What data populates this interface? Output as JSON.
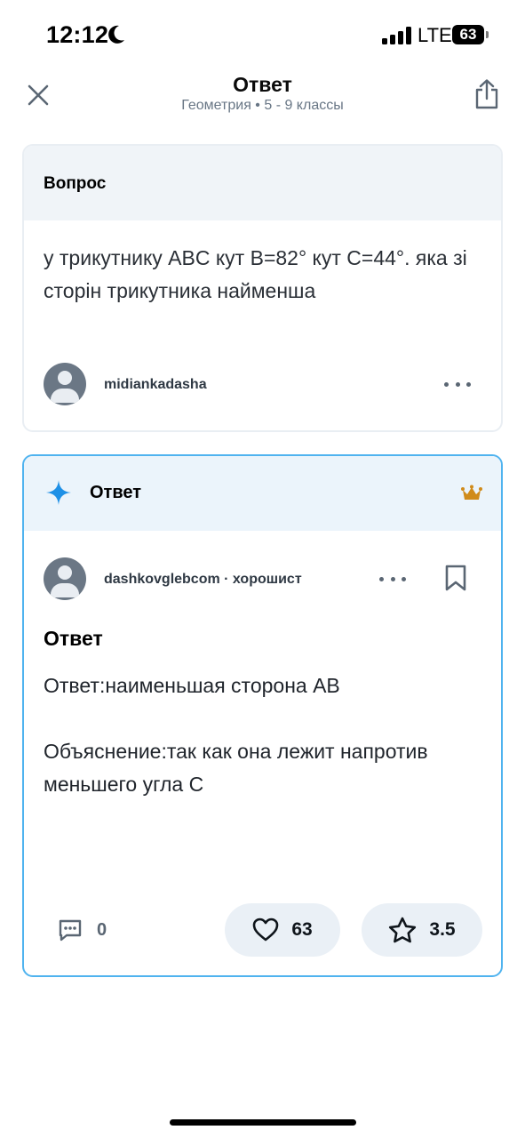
{
  "status_bar": {
    "time": "12:12",
    "network": "LTE",
    "battery": "63"
  },
  "header": {
    "title": "Ответ",
    "subtitle": "Геометрия • 5 - 9 классы"
  },
  "question_card": {
    "label": "Вопрос",
    "text": "у трикутнику ABC кут B=82° кут C=44°. яка зі сторін трикутника найменша",
    "author": "midiankadasha"
  },
  "answer_card": {
    "label": "Ответ",
    "author": "dashkovglebcom · хорошист",
    "heading": "Ответ",
    "paragraph1": "Ответ:наименьшая сторона АВ",
    "paragraph2": "Объяснение:так как она лежит напротив меньшего угла С",
    "comments": "0",
    "likes": "63",
    "rating": "3.5"
  },
  "colors": {
    "accent": "#4fb3ef",
    "sparkle": "#1e90e6",
    "crown": "#d08b1a"
  },
  "icons": [
    "moon-icon",
    "signal-icon",
    "close-icon",
    "share-icon",
    "avatar-icon",
    "more-icon",
    "sparkle-icon",
    "crown-icon",
    "bookmark-icon",
    "comment-icon",
    "heart-icon",
    "star-icon"
  ]
}
